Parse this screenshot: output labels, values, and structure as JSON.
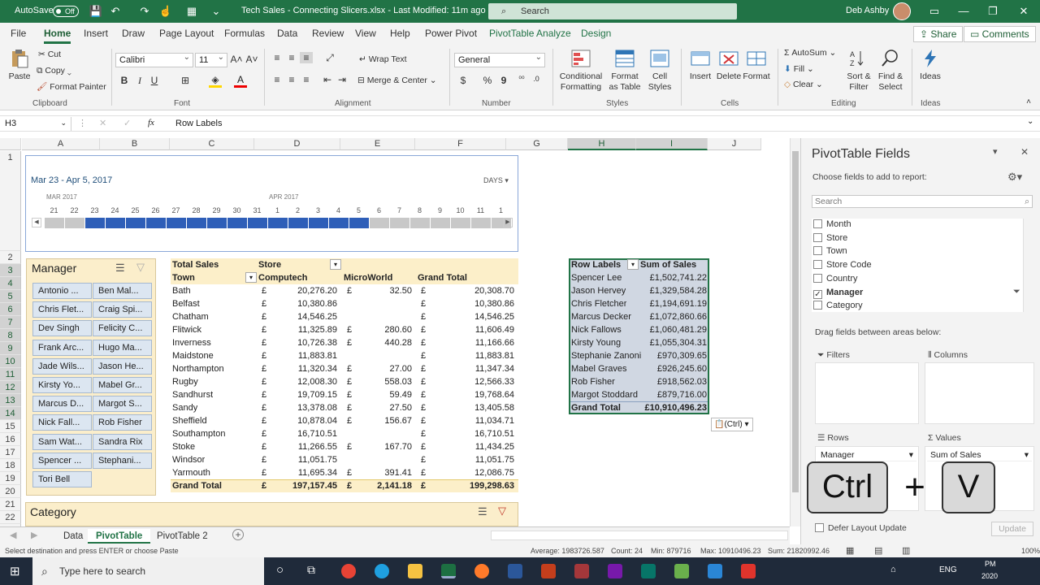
{
  "titlebar": {
    "autosave_label": "AutoSave",
    "autosave_state": "Off",
    "document_title": "Tech Sales - Connecting Slicers.xlsx  -  Last Modified: 11m ago",
    "search_placeholder": "Search",
    "user_name": "Deb Ashby"
  },
  "menu": {
    "tabs": [
      "File",
      "Home",
      "Insert",
      "Draw",
      "Page Layout",
      "Formulas",
      "Data",
      "Review",
      "View",
      "Help",
      "Power Pivot",
      "PivotTable Analyze",
      "Design"
    ],
    "share_label": "Share",
    "comments_label": "Comments"
  },
  "ribbon": {
    "clipboard": {
      "paste": "Paste",
      "cut": "Cut",
      "copy": "Copy",
      "format_painter": "Format Painter",
      "label": "Clipboard"
    },
    "font": {
      "name": "Calibri",
      "size": "11",
      "label": "Font",
      "bold": "B",
      "italic": "I",
      "underline": "U"
    },
    "alignment": {
      "wrap": "Wrap Text",
      "merge": "Merge & Center",
      "label": "Alignment"
    },
    "number": {
      "format": "General",
      "label": "Number",
      "currency": "$",
      "percent": "%",
      "comma": "9"
    },
    "styles": {
      "cond": "Conditional Formatting",
      "table": "Format as Table",
      "cell": "Cell Styles",
      "label": "Styles"
    },
    "cells": {
      "insert": "Insert",
      "delete": "Delete",
      "format": "Format",
      "label": "Cells"
    },
    "editing": {
      "autosum": "AutoSum",
      "fill": "Fill",
      "clear": "Clear",
      "sort": "Sort & Filter",
      "find": "Find & Select",
      "label": "Editing"
    },
    "ideas": {
      "ideas": "Ideas",
      "label": "Ideas"
    }
  },
  "formula_bar": {
    "name_box": "H3",
    "fx": "fx",
    "content": "Row Labels"
  },
  "grid": {
    "columns": [
      "A",
      "B",
      "C",
      "D",
      "E",
      "F",
      "G",
      "H",
      "I",
      "J"
    ],
    "rows": [
      "1",
      "2",
      "3",
      "4",
      "5",
      "6",
      "7",
      "8",
      "9",
      "10",
      "11",
      "12",
      "13",
      "14",
      "15",
      "16",
      "17",
      "18",
      "19",
      "20",
      "21",
      "22",
      "23"
    ]
  },
  "timeline": {
    "range": "Mar 23 - Apr 5, 2017",
    "unit": "DAYS",
    "month1": "MAR 2017",
    "month2": "APR 2017",
    "days": [
      "21",
      "22",
      "23",
      "24",
      "25",
      "26",
      "27",
      "28",
      "29",
      "30",
      "31",
      "1",
      "2",
      "3",
      "4",
      "5",
      "6",
      "7",
      "8",
      "9",
      "10",
      "11",
      "1"
    ],
    "selected_from": 2,
    "selected_to": 15
  },
  "slicer_manager": {
    "title": "Manager",
    "items": [
      "Antonio ...",
      "Ben Mal...",
      "Chris Flet...",
      "Craig Spi...",
      "Dev Singh",
      "Felicity C...",
      "Frank Arc...",
      "Hugo Ma...",
      "Jade Wils...",
      "Jason He...",
      "Kirsty Yo...",
      "Mabel Gr...",
      "Marcus D...",
      "Margot S...",
      "Nick Fall...",
      "Rob Fisher",
      "Sam Wat...",
      "Sandra Rix",
      "Spencer ...",
      "Stephani...",
      "Tori Bell"
    ]
  },
  "slicer_category": {
    "title": "Category"
  },
  "pivot1": {
    "h1": "Total Sales",
    "h2": "Store",
    "town": "Town",
    "stores": [
      "Computech",
      "MicroWorld",
      "Grand Total"
    ],
    "currency": "£",
    "rows": [
      [
        "Bath",
        "20,276.20",
        "32.50",
        "20,308.70"
      ],
      [
        "Belfast",
        "10,380.86",
        "",
        "10,380.86"
      ],
      [
        "Chatham",
        "14,546.25",
        "",
        "14,546.25"
      ],
      [
        "Flitwick",
        "11,325.89",
        "280.60",
        "11,606.49"
      ],
      [
        "Inverness",
        "10,726.38",
        "440.28",
        "11,166.66"
      ],
      [
        "Maidstone",
        "11,883.81",
        "",
        "11,883.81"
      ],
      [
        "Northampton",
        "11,320.34",
        "27.00",
        "11,347.34"
      ],
      [
        "Rugby",
        "12,008.30",
        "558.03",
        "12,566.33"
      ],
      [
        "Sandhurst",
        "19,709.15",
        "59.49",
        "19,768.64"
      ],
      [
        "Sandy",
        "13,378.08",
        "27.50",
        "13,405.58"
      ],
      [
        "Sheffield",
        "10,878.04",
        "156.67",
        "11,034.71"
      ],
      [
        "Southampton",
        "16,710.51",
        "",
        "16,710.51"
      ],
      [
        "Stoke",
        "11,266.55",
        "167.70",
        "11,434.25"
      ],
      [
        "Windsor",
        "11,051.75",
        "",
        "11,051.75"
      ],
      [
        "Yarmouth",
        "11,695.34",
        "391.41",
        "12,086.75"
      ]
    ],
    "grand": [
      "Grand Total",
      "197,157.45",
      "2,141.18",
      "199,298.63"
    ]
  },
  "pivot2": {
    "h1": "Row Labels",
    "h2": "Sum of Sales",
    "rows": [
      [
        "Spencer Lee",
        "£1,502,741.22"
      ],
      [
        "Jason Hervey",
        "£1,329,584.28"
      ],
      [
        "Chris Fletcher",
        "£1,194,691.19"
      ],
      [
        "Marcus Decker",
        "£1,072,860.66"
      ],
      [
        "Nick Fallows",
        "£1,060,481.29"
      ],
      [
        "Kirsty Young",
        "£1,055,304.31"
      ],
      [
        "Stephanie Zanoni",
        "£970,309.65"
      ],
      [
        "Mabel Graves",
        "£926,245.60"
      ],
      [
        "Rob Fisher",
        "£918,562.03"
      ],
      [
        "Margot Stoddard",
        "£879,716.00"
      ]
    ],
    "grand": [
      "Grand Total",
      "£10,910,496.23"
    ],
    "paste_options": "(Ctrl)"
  },
  "sheet_tabs": [
    "Data",
    "PivotTable",
    "PivotTable 2"
  ],
  "status": {
    "message": "Select destination and press ENTER or choose Paste",
    "average": "Average: 1983726.587",
    "count": "Count: 24",
    "min": "Min: 879716",
    "max": "Max: 10910496.23",
    "sum": "Sum: 21820992.46",
    "zoom": "100%"
  },
  "pane": {
    "title": "PivotTable Fields",
    "subtitle": "Choose fields to add to report:",
    "search_placeholder": "Search",
    "fields": [
      {
        "name": "Month",
        "checked": false
      },
      {
        "name": "Store",
        "checked": false
      },
      {
        "name": "Town",
        "checked": false
      },
      {
        "name": "Store Code",
        "checked": false
      },
      {
        "name": "Country",
        "checked": false
      },
      {
        "name": "Manager",
        "checked": true
      },
      {
        "name": "Category",
        "checked": false
      }
    ],
    "drag_label": "Drag fields between areas below:",
    "filters": "Filters",
    "columns": "Columns",
    "rows": "Rows",
    "values": "Values",
    "rows_item": "Manager",
    "values_item": "Sum of Sales",
    "defer": "Defer Layout Update",
    "update": "Update"
  },
  "keys": {
    "ctrl": "Ctrl",
    "plus": "+",
    "v": "V"
  },
  "taskbar": {
    "search_placeholder": "Type here to search",
    "lang": "ENG",
    "time": "PM",
    "year": "2020"
  }
}
